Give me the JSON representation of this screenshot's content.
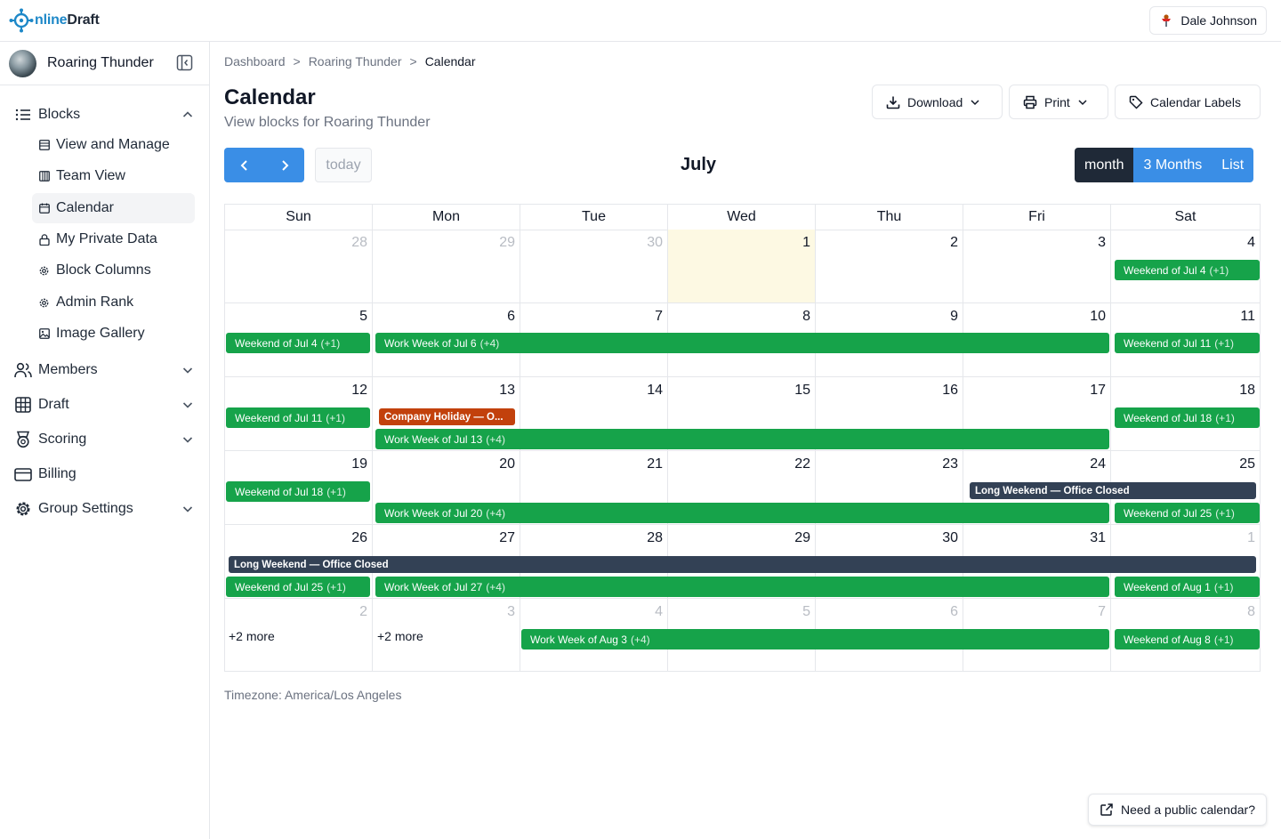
{
  "app": {
    "brand_prefix": "O",
    "brand_middle": "nline",
    "brand_suffix": "Draft",
    "user_name": "Dale Johnson"
  },
  "sidebar": {
    "group_name": "Roaring Thunder",
    "top_items": [
      {
        "label": "Blocks",
        "icon": "list-icon",
        "expanded": true
      },
      {
        "label": "Members",
        "icon": "users-icon",
        "expanded": false
      },
      {
        "label": "Draft",
        "icon": "grid-icon",
        "expanded": false
      },
      {
        "label": "Scoring",
        "icon": "badge-icon",
        "expanded": false
      },
      {
        "label": "Billing",
        "icon": "credit-card-icon"
      },
      {
        "label": "Group Settings",
        "icon": "gear-icon",
        "expanded": false
      }
    ],
    "block_items": [
      {
        "label": "View and Manage",
        "icon": "table-icon"
      },
      {
        "label": "Team View",
        "icon": "columns-icon"
      },
      {
        "label": "Calendar",
        "icon": "calendar-icon",
        "active": true
      },
      {
        "label": "My Private Data",
        "icon": "lock-icon"
      },
      {
        "label": "Block Columns",
        "icon": "gear-icon"
      },
      {
        "label": "Admin Rank",
        "icon": "gear-icon"
      },
      {
        "label": "Image Gallery",
        "icon": "image-icon"
      }
    ]
  },
  "breadcrumb": {
    "items": [
      "Dashboard",
      "Roaring Thunder",
      "Calendar"
    ],
    "separator": ">"
  },
  "page": {
    "title": "Calendar",
    "subtitle": "View blocks for Roaring Thunder"
  },
  "actions": {
    "download": "Download",
    "print": "Print",
    "labels": "Calendar Labels"
  },
  "toolbar": {
    "today": "today",
    "month_title": "July",
    "views": [
      "month",
      "3 Months",
      "List"
    ],
    "active_view": "month"
  },
  "calendar": {
    "weekdays": [
      "Sun",
      "Mon",
      "Tue",
      "Wed",
      "Thu",
      "Fri",
      "Sat"
    ],
    "weeks": [
      [
        "28",
        "29",
        "30",
        "1",
        "2",
        "3",
        "4"
      ],
      [
        "5",
        "6",
        "7",
        "8",
        "9",
        "10",
        "11"
      ],
      [
        "12",
        "13",
        "14",
        "15",
        "16",
        "17",
        "18"
      ],
      [
        "19",
        "20",
        "21",
        "22",
        "23",
        "24",
        "25"
      ],
      [
        "26",
        "27",
        "28",
        "29",
        "30",
        "31",
        "1"
      ],
      [
        "2",
        "3",
        "4",
        "5",
        "6",
        "7",
        "8"
      ]
    ],
    "events": {
      "w1_sat": {
        "title": "Weekend of Jul 4",
        "extra": "(+1)"
      },
      "w2_sun": {
        "title": "Weekend of Jul 4",
        "extra": "(+1)"
      },
      "w2_work": {
        "title": "Work Week of Jul 6",
        "extra": "(+4)"
      },
      "w2_sat": {
        "title": "Weekend of Jul 11",
        "extra": "(+1)"
      },
      "w3_sun": {
        "title": "Weekend of Jul 11",
        "extra": "(+1)"
      },
      "w3_holiday": {
        "title": "Company Holiday — O..."
      },
      "w3_work": {
        "title": "Work Week of Jul 13",
        "extra": "(+4)"
      },
      "w3_sat": {
        "title": "Weekend of Jul 18",
        "extra": "(+1)"
      },
      "w4_sun": {
        "title": "Weekend of Jul 18",
        "extra": "(+1)"
      },
      "w4_long": {
        "title": "Long Weekend — Office Closed"
      },
      "w4_work": {
        "title": "Work Week of Jul 20",
        "extra": "(+4)"
      },
      "w4_sat": {
        "title": "Weekend of Jul 25",
        "extra": "(+1)"
      },
      "w5_long": {
        "title": "Long Weekend — Office Closed"
      },
      "w5_sun": {
        "title": "Weekend of Jul 25",
        "extra": "(+1)"
      },
      "w5_work": {
        "title": "Work Week of Jul 27",
        "extra": "(+4)"
      },
      "w5_sat": {
        "title": "Weekend of Aug 1",
        "extra": "(+1)"
      },
      "w6_work": {
        "title": "Work Week of Aug 3",
        "extra": "(+4)"
      },
      "w6_sat": {
        "title": "Weekend of Aug 8",
        "extra": "(+1)"
      }
    },
    "more_sun": "+2 more",
    "more_mon": "+2 more"
  },
  "timezone": "Timezone: America/Los Angeles",
  "public_calendar": "Need a public calendar?",
  "colors": {
    "primary": "#3a8ee6",
    "event_green": "#16a34a",
    "event_slate": "#334155",
    "event_orange": "#c2410c",
    "today_bg": "#fdf9e3",
    "active_view": "#1f2937"
  }
}
